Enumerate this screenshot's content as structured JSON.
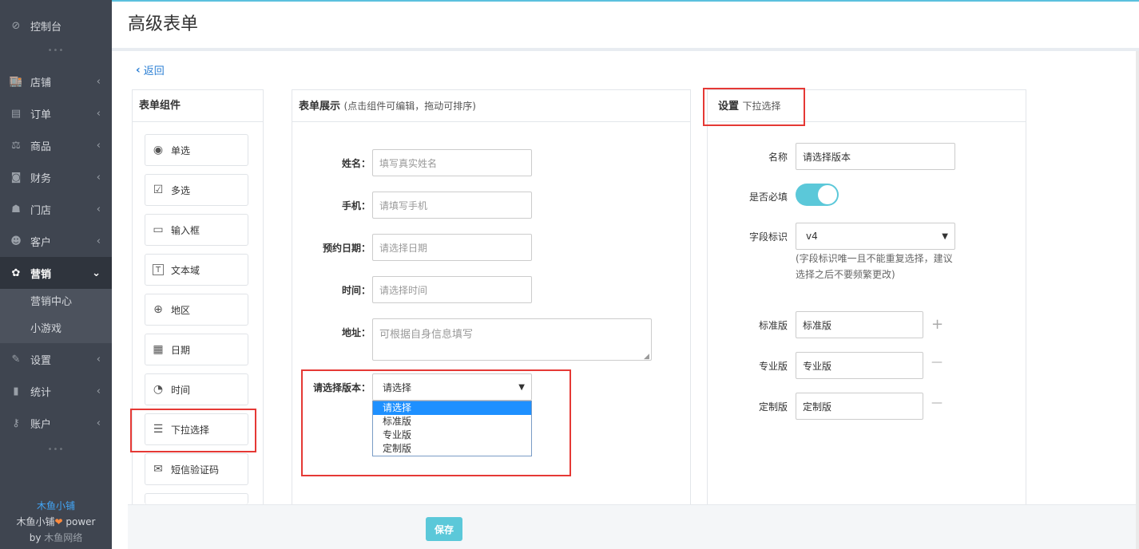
{
  "sidebar": {
    "dashboard": "控制台",
    "items": [
      {
        "label": "店铺",
        "icon": "store-icon",
        "glyph": "🏬"
      },
      {
        "label": "订单",
        "icon": "order-icon",
        "glyph": "▤"
      },
      {
        "label": "商品",
        "icon": "scale-icon",
        "glyph": "⚖"
      },
      {
        "label": "财务",
        "icon": "money-icon",
        "glyph": "◙"
      },
      {
        "label": "门店",
        "icon": "sitemap-icon",
        "glyph": "☗"
      },
      {
        "label": "客户",
        "icon": "users-icon",
        "glyph": "☻"
      }
    ],
    "active": {
      "label": "营销",
      "icon": "gift-icon",
      "glyph": "✿"
    },
    "subitems": [
      "营销中心",
      "小游戏"
    ],
    "items_after": [
      {
        "label": "设置",
        "icon": "wrench-icon",
        "glyph": "✎"
      },
      {
        "label": "统计",
        "icon": "bar-chart-icon",
        "glyph": "▮"
      },
      {
        "label": "账户",
        "icon": "key-icon",
        "glyph": "⚷"
      }
    ],
    "brand_name": "木鱼小铺",
    "brand_power_prefix": "木鱼小铺",
    "brand_power_suffix": " power",
    "brand_by": "by",
    "brand_company": " 木鱼网络"
  },
  "header": {
    "title": "高级表单"
  },
  "back_label": "返回",
  "components_panel": {
    "title": "表单组件",
    "items": [
      {
        "label": "单选",
        "icon": "radio-icon",
        "glyph": "◉"
      },
      {
        "label": "多选",
        "icon": "checkbox-icon",
        "glyph": "☑"
      },
      {
        "label": "输入框",
        "icon": "input-icon",
        "glyph": "▭"
      },
      {
        "label": "文本域",
        "icon": "textarea-icon",
        "glyph": "T"
      },
      {
        "label": "地区",
        "icon": "globe-icon",
        "glyph": "⊕"
      },
      {
        "label": "日期",
        "icon": "calendar-icon",
        "glyph": "▦"
      },
      {
        "label": "时间",
        "icon": "clock-icon",
        "glyph": "◔"
      },
      {
        "label": "下拉选择",
        "icon": "dropdown-icon",
        "glyph": "☰"
      },
      {
        "label": "短信验证码",
        "icon": "mail-icon",
        "glyph": "✉"
      }
    ]
  },
  "form_panel": {
    "title": "表单展示",
    "subtitle": "(点击组件可编辑，拖动可排序)",
    "fields": [
      {
        "label": "姓名：",
        "placeholder": "填写真实姓名"
      },
      {
        "label": "手机：",
        "placeholder": "请填写手机"
      },
      {
        "label": "预约日期：",
        "placeholder": "请选择日期"
      },
      {
        "label": "时间：",
        "placeholder": "请选择时间"
      }
    ],
    "address_label": "地址：",
    "address_placeholder": "可根据自身信息填写",
    "select_label": "请选择版本：",
    "select_value": "请选择",
    "options": [
      "请选择",
      "标准版",
      "专业版",
      "定制版"
    ]
  },
  "settings_panel": {
    "title": "设置",
    "subtitle": "下拉选择",
    "name_label": "名称",
    "name_value": "请选择版本",
    "required_label": "是否必填",
    "required_on": true,
    "field_id_label": "字段标识",
    "field_id_value": "v4",
    "field_id_hint_1": "(字段标识唯一且不能重复选择，建议",
    "field_id_hint_2": "选择之后不要频繁更改)",
    "options": [
      {
        "label": "标准版",
        "value": "标准版",
        "action": "+"
      },
      {
        "label": "专业版",
        "value": "专业版",
        "action": "—"
      },
      {
        "label": "定制版",
        "value": "定制版",
        "action": "—"
      }
    ]
  },
  "footer": {
    "save_label": "保存"
  },
  "colors": {
    "accent": "#5bc8d9",
    "sidebar": "#3f4550",
    "highlight": "#e53935",
    "link": "#2b7fd4"
  }
}
